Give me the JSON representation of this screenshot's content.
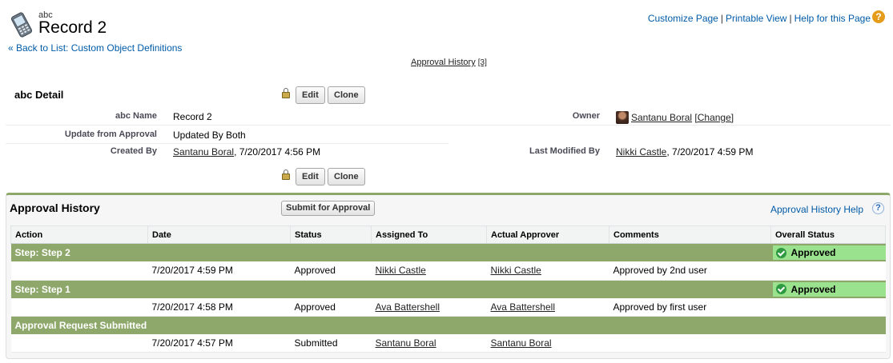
{
  "header": {
    "object_type": "abc",
    "record_title": "Record 2",
    "back_link": "« Back to List: Custom Object Definitions",
    "top_links": [
      "Customize Page",
      "Printable View",
      "Help for this Page"
    ],
    "related_list_link": "Approval History",
    "related_list_count": "[3]",
    "icons": {
      "page": "mobile-device-icon",
      "help": "help-icon"
    }
  },
  "detail": {
    "title": "abc Detail",
    "edit_label": "Edit",
    "clone_label": "Clone",
    "fields": {
      "name_label": "abc Name",
      "name_value": "Record 2",
      "owner_label": "Owner",
      "owner_value": "Santanu Boral",
      "owner_change": "[Change]",
      "update_label": "Update from Approval",
      "update_value": "Updated By Both",
      "created_label": "Created By",
      "created_user": "Santanu Boral",
      "created_date": ", 7/20/2017 4:56 PM",
      "modified_label": "Last Modified By",
      "modified_user": "Nikki Castle",
      "modified_date": ", 7/20/2017 4:59 PM"
    }
  },
  "approval_history": {
    "title": "Approval History",
    "submit_label": "Submit for Approval",
    "help_link": "Approval History Help",
    "columns": [
      "Action",
      "Date",
      "Status",
      "Assigned To",
      "Actual Approver",
      "Comments",
      "Overall Status"
    ],
    "step2": {
      "label": "Step: Step 2",
      "overall": "Approved",
      "date": "7/20/2017 4:59 PM",
      "status": "Approved",
      "assigned": "Nikki Castle",
      "approver": "Nikki Castle",
      "comments": "Approved by 2nd user"
    },
    "step1": {
      "label": "Step: Step 1",
      "overall": "Approved",
      "date": "7/20/2017 4:58 PM",
      "status": "Approved",
      "assigned": "Ava Battershell",
      "approver": "Ava Battershell",
      "comments": "Approved by first user"
    },
    "submitted": {
      "label": "Approval Request Submitted",
      "date": "7/20/2017 4:57 PM",
      "status": "Submitted",
      "assigned": "Santanu Boral",
      "approver": "Santanu Boral"
    },
    "colors": {
      "step_bar": "#8ea86b",
      "approved_badge": "#9be28e",
      "check": "#2f9a41"
    }
  }
}
